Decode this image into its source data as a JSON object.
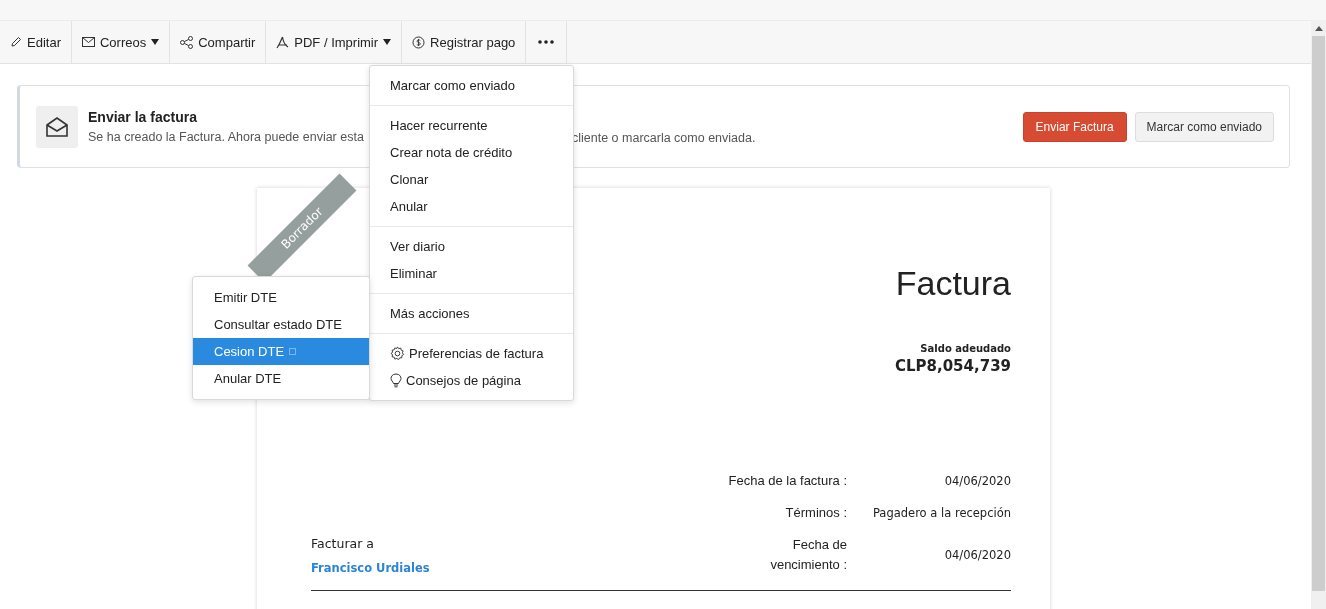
{
  "toolbar": {
    "items": [
      {
        "label": "Editar",
        "has_menu": false
      },
      {
        "label": "Correos",
        "has_menu": true
      },
      {
        "label": "Compartir",
        "has_menu": false
      },
      {
        "label": "PDF / Imprimir",
        "has_menu": true
      },
      {
        "label": "Registrar pago",
        "has_menu": false
      }
    ]
  },
  "banner": {
    "title": "Enviar la factura",
    "text_before": "Se ha creado la Factura. Ahora puede enviar esta",
    "text_after": "cliente o marcarla como enviada.",
    "primary_button": "Enviar Factura",
    "secondary_button": "Marcar como enviado"
  },
  "document": {
    "ribbon": "Borrador",
    "title": "Factura",
    "balance_label": "Saldo adeudado",
    "balance": "CLP8,054,739",
    "details": [
      {
        "label": "Fecha de la factura :",
        "value": "04/06/2020"
      },
      {
        "label": "Términos :",
        "value": "Pagadero a la recepción"
      },
      {
        "label": "Fecha de vencimiento :",
        "value": "04/06/2020"
      }
    ],
    "bill_to_label": "Facturar a",
    "customer": "Francisco Urdiales"
  },
  "more_menu": {
    "sections": [
      [
        {
          "label": "Marcar como enviado",
          "kind": "plain"
        }
      ],
      [
        {
          "label": "Hacer recurrente",
          "kind": "plain"
        },
        {
          "label": "Crear nota de crédito",
          "kind": "plain"
        },
        {
          "label": "Clonar",
          "kind": "plain"
        },
        {
          "label": "Anular",
          "kind": "plain"
        }
      ],
      [
        {
          "label": "Ver diario",
          "kind": "plain"
        },
        {
          "label": "Eliminar",
          "kind": "plain"
        }
      ],
      [
        {
          "label": "Más acciones",
          "kind": "plain"
        }
      ],
      [
        {
          "label": "Preferencias de factura",
          "kind": "settings"
        },
        {
          "label": "Consejos de página",
          "kind": "tip"
        }
      ]
    ]
  },
  "submenu": {
    "items": [
      {
        "label": "Emitir DTE",
        "selected": false,
        "external": false
      },
      {
        "label": "Consultar estado DTE",
        "selected": false,
        "external": false
      },
      {
        "label": "Cesion DTE",
        "selected": true,
        "external": true
      },
      {
        "label": "Anular DTE",
        "selected": false,
        "external": false
      }
    ]
  }
}
